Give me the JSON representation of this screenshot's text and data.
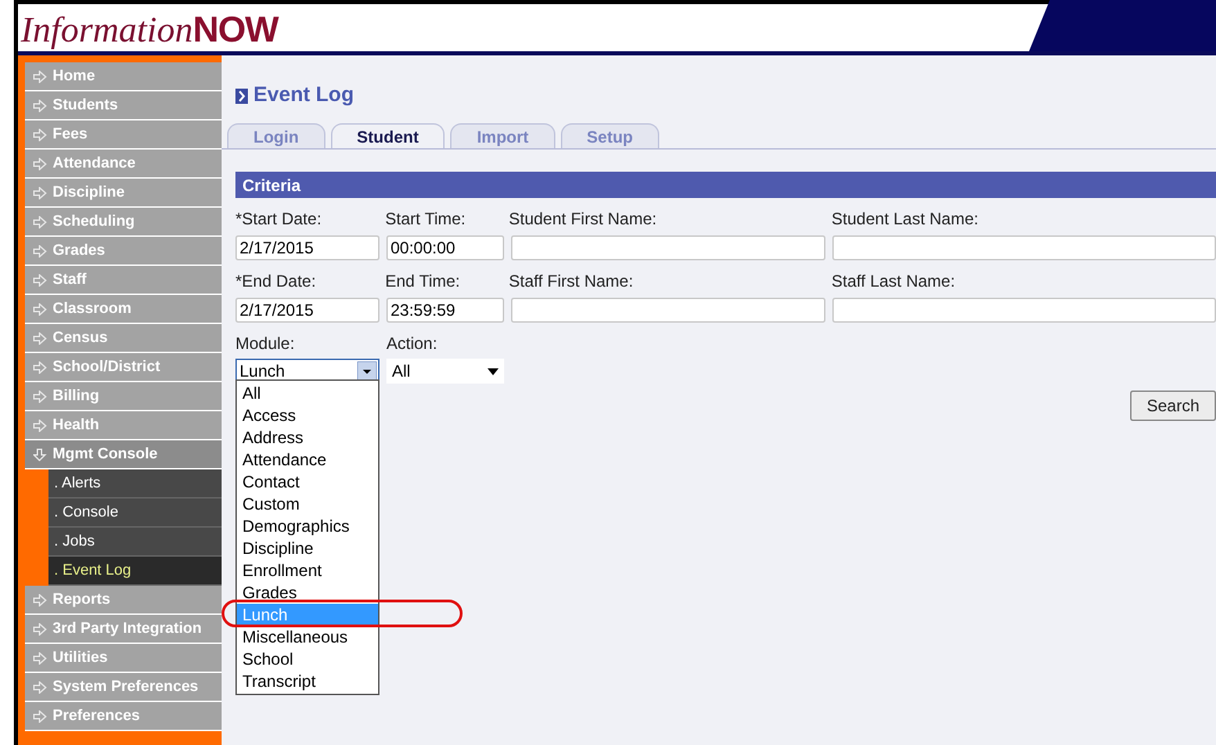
{
  "logo": {
    "light": "Information",
    "bold": "NOW"
  },
  "sidebar": {
    "items": [
      {
        "label": "Home",
        "expanded": false
      },
      {
        "label": "Students",
        "expanded": false
      },
      {
        "label": "Fees",
        "expanded": false
      },
      {
        "label": "Attendance",
        "expanded": false
      },
      {
        "label": "Discipline",
        "expanded": false
      },
      {
        "label": "Scheduling",
        "expanded": false
      },
      {
        "label": "Grades",
        "expanded": false
      },
      {
        "label": "Staff",
        "expanded": false
      },
      {
        "label": "Classroom",
        "expanded": false
      },
      {
        "label": "Census",
        "expanded": false
      },
      {
        "label": "School/District",
        "expanded": false
      },
      {
        "label": "Billing",
        "expanded": false
      },
      {
        "label": "Health",
        "expanded": false
      },
      {
        "label": "Mgmt Console",
        "expanded": true,
        "children": [
          {
            "label": ". Alerts",
            "selected": false
          },
          {
            "label": ". Console",
            "selected": false
          },
          {
            "label": ". Jobs",
            "selected": false
          },
          {
            "label": ". Event Log",
            "selected": true
          }
        ]
      },
      {
        "label": "Reports",
        "expanded": false
      },
      {
        "label": "3rd Party Integration",
        "expanded": false
      },
      {
        "label": "Utilities",
        "expanded": false
      },
      {
        "label": "System Preferences",
        "expanded": false
      },
      {
        "label": "Preferences",
        "expanded": false
      }
    ]
  },
  "page_title": "Event Log",
  "tabs": [
    {
      "label": "Login",
      "selected": false
    },
    {
      "label": "Student",
      "selected": true
    },
    {
      "label": "Import",
      "selected": false
    },
    {
      "label": "Setup",
      "selected": false
    }
  ],
  "criteria": {
    "title": "Criteria",
    "rows": [
      [
        {
          "label": "*Start Date:",
          "value": "2/17/2015"
        },
        {
          "label": "Start Time:",
          "value": "00:00:00"
        },
        {
          "label": "Student First Name:"
        },
        {
          "label": "Student Last Name:"
        }
      ],
      [
        {
          "label": "*End Date:",
          "value": "2/17/2015"
        },
        {
          "label": "End Time:",
          "value": "23:59:59"
        },
        {
          "label": "Staff First Name:"
        },
        {
          "label": "Staff Last Name:"
        }
      ]
    ],
    "module": {
      "label": "Module:",
      "value": "Lunch",
      "open": true,
      "options": [
        {
          "label": "All",
          "selected": false
        },
        {
          "label": "Access",
          "selected": false
        },
        {
          "label": "Address",
          "selected": false
        },
        {
          "label": "Attendance",
          "selected": false
        },
        {
          "label": "Contact",
          "selected": false
        },
        {
          "label": "Custom",
          "selected": false
        },
        {
          "label": "Demographics",
          "selected": false
        },
        {
          "label": "Discipline",
          "selected": false
        },
        {
          "label": "Enrollment",
          "selected": false
        },
        {
          "label": "Grades",
          "selected": false
        },
        {
          "label": "Lunch",
          "selected": true
        },
        {
          "label": "Miscellaneous",
          "selected": false
        },
        {
          "label": "School",
          "selected": false
        },
        {
          "label": "Transcript",
          "selected": false
        }
      ]
    },
    "action": {
      "label": "Action:",
      "value": "All"
    },
    "search_button": "Search"
  }
}
